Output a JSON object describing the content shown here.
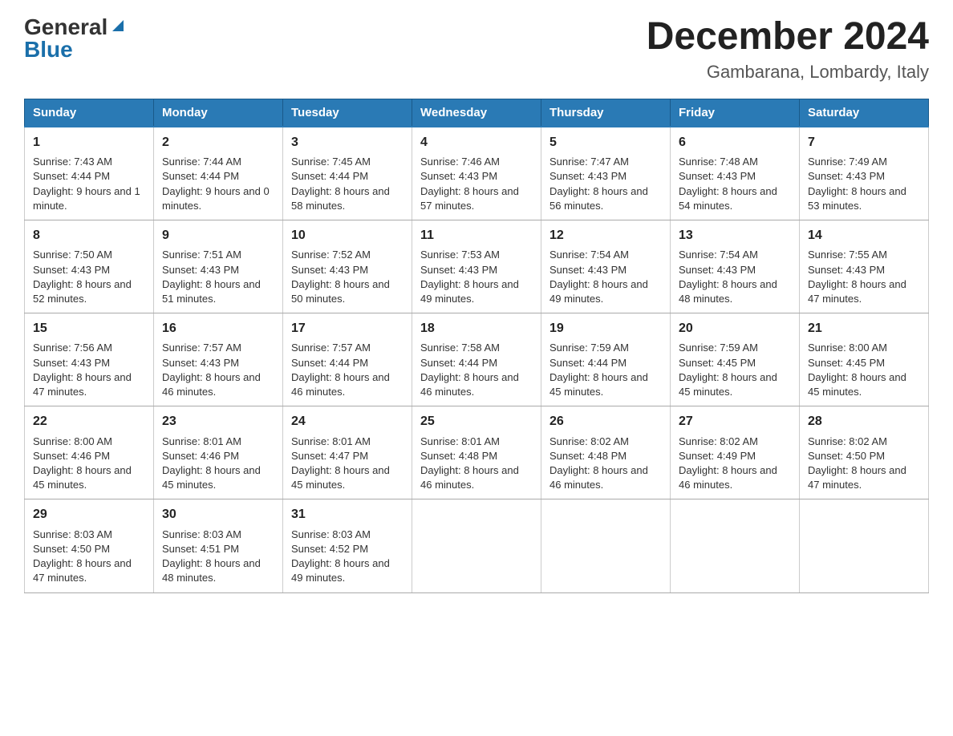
{
  "header": {
    "logo_general": "General",
    "logo_blue": "Blue",
    "title": "December 2024",
    "subtitle": "Gambarana, Lombardy, Italy"
  },
  "days_of_week": [
    "Sunday",
    "Monday",
    "Tuesday",
    "Wednesday",
    "Thursday",
    "Friday",
    "Saturday"
  ],
  "weeks": [
    [
      {
        "day": "1",
        "sunrise": "7:43 AM",
        "sunset": "4:44 PM",
        "daylight": "9 hours and 1 minute."
      },
      {
        "day": "2",
        "sunrise": "7:44 AM",
        "sunset": "4:44 PM",
        "daylight": "9 hours and 0 minutes."
      },
      {
        "day": "3",
        "sunrise": "7:45 AM",
        "sunset": "4:44 PM",
        "daylight": "8 hours and 58 minutes."
      },
      {
        "day": "4",
        "sunrise": "7:46 AM",
        "sunset": "4:43 PM",
        "daylight": "8 hours and 57 minutes."
      },
      {
        "day": "5",
        "sunrise": "7:47 AM",
        "sunset": "4:43 PM",
        "daylight": "8 hours and 56 minutes."
      },
      {
        "day": "6",
        "sunrise": "7:48 AM",
        "sunset": "4:43 PM",
        "daylight": "8 hours and 54 minutes."
      },
      {
        "day": "7",
        "sunrise": "7:49 AM",
        "sunset": "4:43 PM",
        "daylight": "8 hours and 53 minutes."
      }
    ],
    [
      {
        "day": "8",
        "sunrise": "7:50 AM",
        "sunset": "4:43 PM",
        "daylight": "8 hours and 52 minutes."
      },
      {
        "day": "9",
        "sunrise": "7:51 AM",
        "sunset": "4:43 PM",
        "daylight": "8 hours and 51 minutes."
      },
      {
        "day": "10",
        "sunrise": "7:52 AM",
        "sunset": "4:43 PM",
        "daylight": "8 hours and 50 minutes."
      },
      {
        "day": "11",
        "sunrise": "7:53 AM",
        "sunset": "4:43 PM",
        "daylight": "8 hours and 49 minutes."
      },
      {
        "day": "12",
        "sunrise": "7:54 AM",
        "sunset": "4:43 PM",
        "daylight": "8 hours and 49 minutes."
      },
      {
        "day": "13",
        "sunrise": "7:54 AM",
        "sunset": "4:43 PM",
        "daylight": "8 hours and 48 minutes."
      },
      {
        "day": "14",
        "sunrise": "7:55 AM",
        "sunset": "4:43 PM",
        "daylight": "8 hours and 47 minutes."
      }
    ],
    [
      {
        "day": "15",
        "sunrise": "7:56 AM",
        "sunset": "4:43 PM",
        "daylight": "8 hours and 47 minutes."
      },
      {
        "day": "16",
        "sunrise": "7:57 AM",
        "sunset": "4:43 PM",
        "daylight": "8 hours and 46 minutes."
      },
      {
        "day": "17",
        "sunrise": "7:57 AM",
        "sunset": "4:44 PM",
        "daylight": "8 hours and 46 minutes."
      },
      {
        "day": "18",
        "sunrise": "7:58 AM",
        "sunset": "4:44 PM",
        "daylight": "8 hours and 46 minutes."
      },
      {
        "day": "19",
        "sunrise": "7:59 AM",
        "sunset": "4:44 PM",
        "daylight": "8 hours and 45 minutes."
      },
      {
        "day": "20",
        "sunrise": "7:59 AM",
        "sunset": "4:45 PM",
        "daylight": "8 hours and 45 minutes."
      },
      {
        "day": "21",
        "sunrise": "8:00 AM",
        "sunset": "4:45 PM",
        "daylight": "8 hours and 45 minutes."
      }
    ],
    [
      {
        "day": "22",
        "sunrise": "8:00 AM",
        "sunset": "4:46 PM",
        "daylight": "8 hours and 45 minutes."
      },
      {
        "day": "23",
        "sunrise": "8:01 AM",
        "sunset": "4:46 PM",
        "daylight": "8 hours and 45 minutes."
      },
      {
        "day": "24",
        "sunrise": "8:01 AM",
        "sunset": "4:47 PM",
        "daylight": "8 hours and 45 minutes."
      },
      {
        "day": "25",
        "sunrise": "8:01 AM",
        "sunset": "4:48 PM",
        "daylight": "8 hours and 46 minutes."
      },
      {
        "day": "26",
        "sunrise": "8:02 AM",
        "sunset": "4:48 PM",
        "daylight": "8 hours and 46 minutes."
      },
      {
        "day": "27",
        "sunrise": "8:02 AM",
        "sunset": "4:49 PM",
        "daylight": "8 hours and 46 minutes."
      },
      {
        "day": "28",
        "sunrise": "8:02 AM",
        "sunset": "4:50 PM",
        "daylight": "8 hours and 47 minutes."
      }
    ],
    [
      {
        "day": "29",
        "sunrise": "8:03 AM",
        "sunset": "4:50 PM",
        "daylight": "8 hours and 47 minutes."
      },
      {
        "day": "30",
        "sunrise": "8:03 AM",
        "sunset": "4:51 PM",
        "daylight": "8 hours and 48 minutes."
      },
      {
        "day": "31",
        "sunrise": "8:03 AM",
        "sunset": "4:52 PM",
        "daylight": "8 hours and 49 minutes."
      },
      null,
      null,
      null,
      null
    ]
  ]
}
